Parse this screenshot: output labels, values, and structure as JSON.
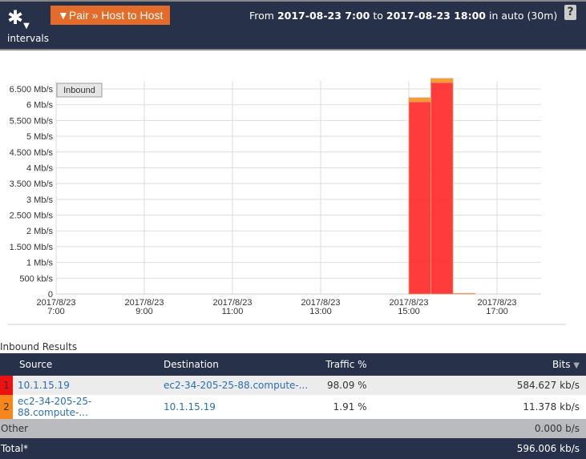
{
  "header": {
    "menu_icon": "gear-icon",
    "pair_button": "▼Pair » Host to Host",
    "from_label": "From",
    "from": "2017-08-23 7:00",
    "to_label": "to",
    "to": "2017-08-23 18:00",
    "suffix": "in auto (30m)",
    "help": "?",
    "intervals": "intervals"
  },
  "chart_data": {
    "type": "area",
    "stacked": true,
    "legend": "Inbound",
    "legend_placement": "top-left",
    "grid": true,
    "yticks": [
      "0",
      "500 kb/s",
      "1 Mb/s",
      "1.500 Mb/s",
      "2 Mb/s",
      "2.500 Mb/s",
      "3 Mb/s",
      "3.500 Mb/s",
      "4 Mb/s",
      "4.500 Mb/s",
      "5 Mb/s",
      "5.500 Mb/s",
      "6 Mb/s",
      "6.500 Mb/s"
    ],
    "ylim_mbps": [
      0,
      6.5
    ],
    "xticks": [
      [
        "2017/8/23",
        "7:00"
      ],
      [
        "2017/8/23",
        "9:00"
      ],
      [
        "2017/8/23",
        "11:00"
      ],
      [
        "2017/8/23",
        "13:00"
      ],
      [
        "2017/8/23",
        "15:00"
      ],
      [
        "2017/8/23",
        "17:00"
      ]
    ],
    "xlim_hours": [
      7,
      18
    ],
    "x_hours": [
      15,
      15.5,
      16
    ],
    "series": [
      {
        "color": "#ff2a2a",
        "values_mbps": [
          6.09,
          6.7,
          0.01
        ]
      },
      {
        "color": "#f7931e",
        "values_mbps": [
          0.13,
          0.13,
          0.01
        ]
      }
    ]
  },
  "results": {
    "title": "Inbound Results",
    "columns": [
      "Source",
      "Destination",
      "Traffic %",
      "Bits"
    ],
    "rows": [
      {
        "n": "1",
        "color": "#ee1111",
        "source": "10.1.15.19",
        "dest": "ec2-34-205-25-88.compute-...",
        "pct": "98.09 %",
        "bits": "584.627 kb/s"
      },
      {
        "n": "2",
        "color": "#f7861b",
        "source": "ec2-34-205-25-88.compute-...",
        "dest": "10.1.15.19",
        "pct": "1.91 %",
        "bits": "11.378 kb/s"
      }
    ],
    "other_label": "Other",
    "other_bits": "0.000 b/s",
    "total_label": "Total*",
    "total_bits": "596.006 kb/s"
  }
}
